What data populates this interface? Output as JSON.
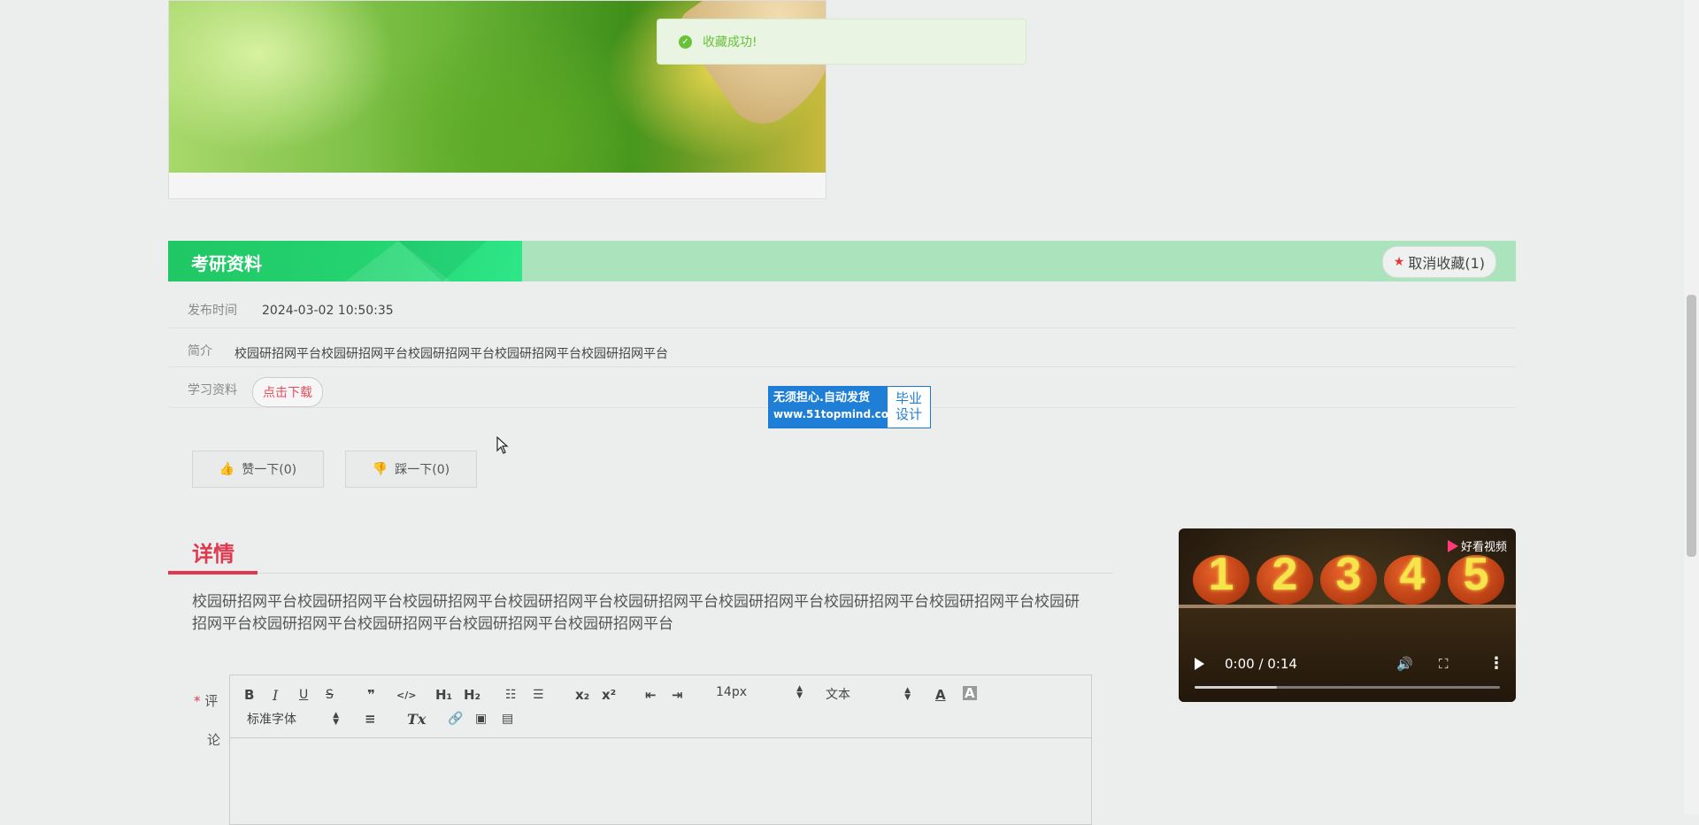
{
  "toast": {
    "message": "收藏成功!",
    "icon": "check-circle-icon",
    "color": "#67c23a"
  },
  "resource": {
    "title": "考研资料",
    "favorite_label": "取消收藏(1)",
    "rows": {
      "publish_label": "发布时间",
      "publish_value": "2024-03-02 10:50:35",
      "intro_label": "简介",
      "intro_value": "校园研招网平台校园研招网平台校园研招网平台校园研招网平台校园研招网平台",
      "material_label": "学习资料",
      "download_label": "点击下载"
    }
  },
  "ad": {
    "line1": "无须担心.自动发货",
    "url": "www.51topmind.com",
    "right_line1": "毕业",
    "right_line2": "设计"
  },
  "votes": {
    "like_label": "赞一下(0)",
    "dislike_label": "踩一下(0)"
  },
  "details": {
    "heading": "详情",
    "text": "校园研招网平台校园研招网平台校园研招网平台校园研招网平台校园研招网平台校园研招网平台校园研招网平台校园研招网平台校园研招网平台校园研招网平台校园研招网平台校园研招网平台校园研招网平台"
  },
  "comment": {
    "required_mark": "*",
    "label_line1": "评",
    "label_line2": "论",
    "toolbar": {
      "bold": "B",
      "italic": "I",
      "underline": "U",
      "strike": "S",
      "quote": "❞",
      "code": "</>",
      "h1": "H₁",
      "h2": "H₂",
      "ordered_list": "☷",
      "bullet_list": "☰",
      "subscript": "x₂",
      "superscript": "x²",
      "outdent": "⇤",
      "indent": "⇥",
      "size_value": "14px",
      "header_value": "文本",
      "font_color": "A",
      "bg_color": "A",
      "font_value": "标准字体",
      "align": "≡",
      "clean": "Tx",
      "link": "🔗",
      "image": "▣",
      "video": "▤"
    }
  },
  "video": {
    "brand": "好看视频",
    "time": "0:00 / 0:14",
    "numbers": [
      "1",
      "2",
      "3",
      "4",
      "5"
    ],
    "progress_buffered": 0.27
  },
  "colors": {
    "accent": "#e0394f",
    "green_bar": "#abe3bd",
    "green_title": "#24d370"
  }
}
